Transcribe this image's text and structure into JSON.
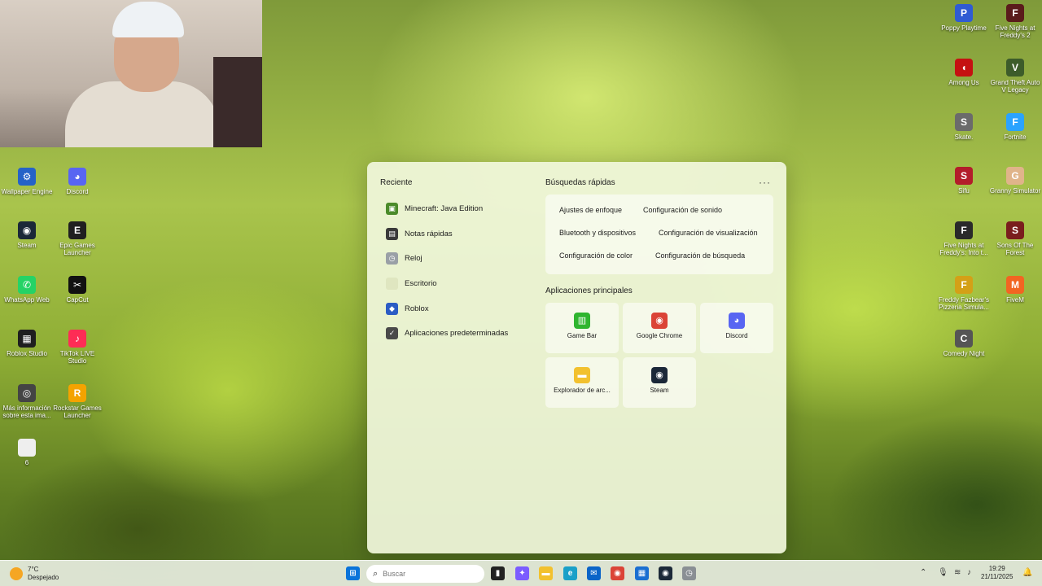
{
  "desktop_left": [
    {
      "label": "Wallpaper Engine",
      "icon": "wallpaper-engine-icon",
      "color": "#2563c7",
      "glyph": "⚙"
    },
    {
      "label": "Discord",
      "icon": "discord-icon",
      "color": "#5865f2",
      "glyph": "◕"
    },
    {
      "label": "Steam",
      "icon": "steam-icon",
      "color": "#1b2838",
      "glyph": "◉"
    },
    {
      "label": "Epic Games Launcher",
      "icon": "epic-games-icon",
      "color": "#202020",
      "glyph": "E"
    },
    {
      "label": "WhatsApp Web",
      "icon": "whatsapp-icon",
      "color": "#25d366",
      "glyph": "✆"
    },
    {
      "label": "CapCut",
      "icon": "capcut-icon",
      "color": "#111111",
      "glyph": "✂"
    },
    {
      "label": "Roblox Studio",
      "icon": "roblox-studio-icon",
      "color": "#1f1f1f",
      "glyph": "▦"
    },
    {
      "label": "TikTok LIVE Studio",
      "icon": "tiktok-live-icon",
      "color": "#fe2c55",
      "glyph": "♪"
    },
    {
      "label": "Más información sobre esta ima...",
      "icon": "info-icon",
      "color": "#444444",
      "glyph": "◎"
    },
    {
      "label": "Rockstar Games Launcher",
      "icon": "rockstar-icon",
      "color": "#f4a300",
      "glyph": "R"
    },
    {
      "label": "6",
      "icon": "file-icon",
      "color": "#eeeeee",
      "glyph": ""
    }
  ],
  "desktop_right": [
    {
      "label": "Poppy Playtime",
      "icon": "poppy-playtime-icon",
      "color": "#2f5bd3",
      "glyph": "P"
    },
    {
      "label": "Five Nights at Freddy's 2",
      "icon": "fnaf2-icon",
      "color": "#5a1b1b",
      "glyph": "F"
    },
    {
      "label": "Among Us",
      "icon": "among-us-icon",
      "color": "#c51111",
      "glyph": "◖"
    },
    {
      "label": "Grand Theft Auto V Legacy",
      "icon": "gta-v-icon",
      "color": "#3d5c2a",
      "glyph": "V"
    },
    {
      "label": "Skate.",
      "icon": "skate-icon",
      "color": "#6b6b6b",
      "glyph": "S"
    },
    {
      "label": "Fortnite",
      "icon": "fortnite-icon",
      "color": "#2aa3ff",
      "glyph": "F"
    },
    {
      "label": "Sifu",
      "icon": "sifu-icon",
      "color": "#b31d2a",
      "glyph": "S"
    },
    {
      "label": "Granny Simulator",
      "icon": "granny-simulator-icon",
      "color": "#e0b48a",
      "glyph": "G"
    },
    {
      "label": "Five Nights at Freddy's: Into t...",
      "icon": "fnaf-into-icon",
      "color": "#2a2a2a",
      "glyph": "F"
    },
    {
      "label": "Sons Of The Forest",
      "icon": "sons-of-the-forest-icon",
      "color": "#7a1d1d",
      "glyph": "S"
    },
    {
      "label": "Freddy Fazbear's Pizzeria Simula...",
      "icon": "ffps-icon",
      "color": "#d4a017",
      "glyph": "F"
    },
    {
      "label": "FiveM",
      "icon": "fivem-icon",
      "color": "#f26522",
      "glyph": "M"
    },
    {
      "label": "Comedy Night",
      "icon": "comedy-night-icon",
      "color": "#555555",
      "glyph": "C"
    }
  ],
  "panel": {
    "recent_title": "Reciente",
    "recent": [
      {
        "label": "Minecraft: Java Edition",
        "icon": "minecraft-icon",
        "color": "#4b8b2a",
        "glyph": "▣"
      },
      {
        "label": "Notas rápidas",
        "icon": "sticky-notes-icon",
        "color": "#3a3a3a",
        "glyph": "▤"
      },
      {
        "label": "Reloj",
        "icon": "clock-icon",
        "color": "#9aa0a6",
        "glyph": "◷"
      },
      {
        "label": "Escritorio",
        "icon": "desktop-icon",
        "color": "#dfe6c0",
        "glyph": ""
      },
      {
        "label": "Roblox",
        "icon": "roblox-icon",
        "color": "#2b5cc4",
        "glyph": "◆"
      },
      {
        "label": "Aplicaciones predeterminadas",
        "icon": "default-apps-icon",
        "color": "#4a4a4a",
        "glyph": "✓"
      }
    ],
    "quick_title": "Búsquedas rápidas",
    "more": "···",
    "quick": [
      "Ajustes de enfoque",
      "Configuración de sonido",
      "Bluetooth y dispositivos",
      "Configuración de visualización",
      "Configuración de color",
      "Configuración de búsqueda"
    ],
    "apps_title": "Aplicaciones principales",
    "apps": [
      {
        "label": "Game Bar",
        "icon": "game-bar-icon",
        "color": "#2fb52f",
        "glyph": "▥"
      },
      {
        "label": "Google Chrome",
        "icon": "chrome-icon",
        "color": "#db4437",
        "glyph": "◉"
      },
      {
        "label": "Discord",
        "icon": "discord-icon",
        "color": "#5865f2",
        "glyph": "◕"
      },
      {
        "label": "Explorador de arc...",
        "icon": "file-explorer-icon",
        "color": "#f2c12e",
        "glyph": "▬"
      },
      {
        "label": "Steam",
        "icon": "steam-icon",
        "color": "#1b2838",
        "glyph": "◉"
      }
    ]
  },
  "taskbar": {
    "weather_temp": "7°C",
    "weather_desc": "Despejado",
    "search_placeholder": "Buscar",
    "pinned": [
      {
        "icon": "windows-start-icon",
        "color": "#0a74da",
        "glyph": "⊞"
      },
      {
        "icon": "task-view-icon",
        "color": "#222222",
        "glyph": "▮"
      },
      {
        "icon": "copilot-icon",
        "color": "#7b5cff",
        "glyph": "✦"
      },
      {
        "icon": "file-explorer-icon",
        "color": "#f2c12e",
        "glyph": "▬"
      },
      {
        "icon": "edge-icon",
        "color": "#1aa0c8",
        "glyph": "e"
      },
      {
        "icon": "outlook-icon",
        "color": "#0a64c8",
        "glyph": "✉"
      },
      {
        "icon": "chrome-icon",
        "color": "#db4437",
        "glyph": "◉"
      },
      {
        "icon": "microsoft-store-icon",
        "color": "#1b6fd1",
        "glyph": "▦"
      },
      {
        "icon": "steam-icon",
        "color": "#1b2838",
        "glyph": "◉"
      },
      {
        "icon": "clock-icon",
        "color": "#8a8f94",
        "glyph": "◷"
      }
    ],
    "time": "19:29",
    "date": "21/11/2025"
  }
}
